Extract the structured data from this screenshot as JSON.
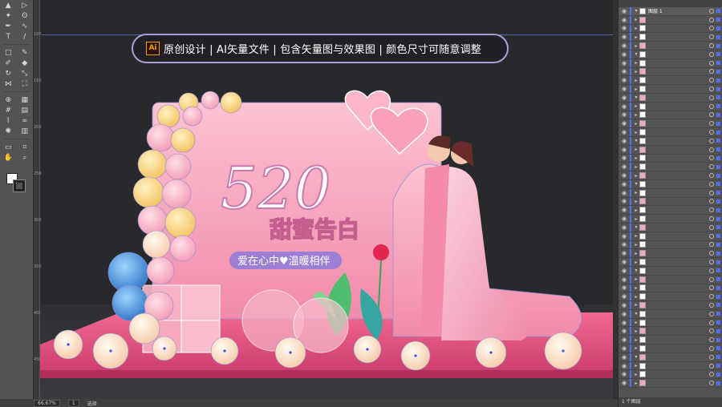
{
  "banner": {
    "ai_logo": "Ai",
    "text": "原创设计 | AI矢量文件 | 包含矢量图与效果图 | 颜色尺寸可随意调整"
  },
  "artwork": {
    "title_main": "520",
    "title_sub": "甜蜜告白",
    "tagline": "爱在心中♥温暖相伴"
  },
  "colors": {
    "accent": "#4f6fff",
    "backdrop_pink": "#f6a3bd",
    "floor_pink": "#e34d7d",
    "balloon_yellow": "#f9d37a",
    "balloon_blue": "#3f8fd6"
  },
  "tools": [
    [
      "selection-tool",
      "direct-selection-tool"
    ],
    [
      "magic-wand-tool",
      "lasso-tool"
    ],
    [
      "pen-tool",
      "curvature-tool"
    ],
    [
      "type-tool",
      "line-tool"
    ],
    [
      "rectangle-tool",
      "paintbrush-tool"
    ],
    [
      "shaper-tool",
      "eraser-tool"
    ],
    [
      "rotate-tool",
      "scale-tool"
    ],
    [
      "width-tool",
      "free-transform-tool"
    ],
    [
      "shape-builder-tool",
      "perspective-grid-tool"
    ],
    [
      "mesh-tool",
      "gradient-tool"
    ],
    [
      "eyedropper-tool",
      "blend-tool"
    ],
    [
      "symbol-sprayer-tool",
      "column-graph-tool"
    ],
    [
      "artboard-tool",
      "slice-tool"
    ],
    [
      "hand-tool",
      "zoom-tool"
    ]
  ],
  "tool_glyphs": {
    "selection-tool": "▲",
    "direct-selection-tool": "▷",
    "magic-wand-tool": "✦",
    "lasso-tool": "ʘ",
    "pen-tool": "✒",
    "curvature-tool": "∿",
    "type-tool": "T",
    "line-tool": "/",
    "rectangle-tool": "□",
    "paintbrush-tool": "✎",
    "shaper-tool": "✐",
    "eraser-tool": "◆",
    "rotate-tool": "↻",
    "scale-tool": "⤡",
    "width-tool": "⋈",
    "free-transform-tool": "⛶",
    "shape-builder-tool": "⊕",
    "perspective-grid-tool": "▦",
    "mesh-tool": "#",
    "gradient-tool": "▤",
    "eyedropper-tool": "⌇",
    "blend-tool": "∞",
    "symbol-sprayer-tool": "✺",
    "column-graph-tool": "▥",
    "artboard-tool": "▭",
    "slice-tool": "⌗",
    "hand-tool": "✋",
    "zoom-tool": "⌕"
  },
  "ruler": [
    "100",
    "150",
    "200",
    "250",
    "300",
    "350",
    "400",
    "450"
  ],
  "layers": {
    "top_layer_name": "图层 1",
    "footer": "1 个图层",
    "row_count": 44
  },
  "status": {
    "zoom": "66.67%",
    "artboard": "1",
    "mode": "选择"
  }
}
